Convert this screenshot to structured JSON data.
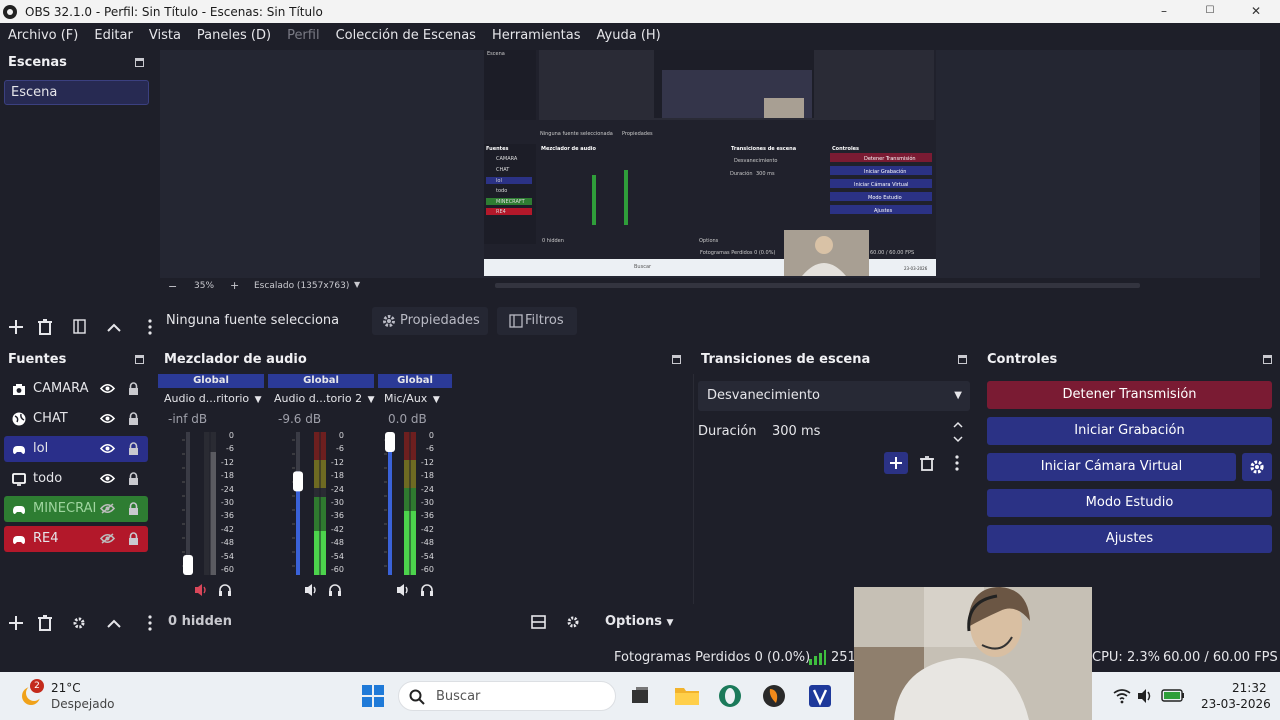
{
  "window": {
    "title": "OBS 32.1.0 - Perfil: Sin Título - Escenas: Sin Título",
    "min": "–",
    "max": "☐",
    "close": "✕"
  },
  "menu": [
    "Archivo (F)",
    "Editar",
    "Vista",
    "Paneles (D)",
    "Perfil",
    "Colección de Escenas",
    "Herramientas",
    "Ayuda (H)"
  ],
  "scenes": {
    "title": "Escenas",
    "items": [
      "Escena"
    ]
  },
  "preview": {
    "zoom": "35%",
    "scale_label": "Escalado (1357x763)",
    "inner": {
      "scene": "Escena",
      "no_source": "Ninguna fuente seleccionada",
      "props": "Propiedades",
      "filters": "Filtros",
      "sources_title": "Fuentes",
      "mixer_title": "Mezclador de audio",
      "transitions_title": "Transiciones de escena",
      "controls_title": "Controles",
      "fade": "Desvanecimiento",
      "duration": "Duración",
      "duration_value": "300 ms",
      "sources": [
        "CAMARA",
        "CHAT",
        "lol",
        "todo",
        "MINECRAFT",
        "RE4"
      ],
      "controls": [
        "Detener Transmisión",
        "Iniciar Grabación",
        "Iniciar Cámara Virtual",
        "Modo Estudio",
        "Ajustes"
      ],
      "status": "Fotogramas Perdidos 0 (0.0%)",
      "cpu": "CPU: 2.3%",
      "fps": "60.00 / 60.00 FPS",
      "search": "Buscar",
      "hidden": "0 hidden",
      "options": "Options",
      "time": "23-03-2026"
    }
  },
  "context": {
    "no_source": "Ninguna fuente selecciona",
    "properties": "Propiedades",
    "filters": "Filtros"
  },
  "sources": {
    "title": "Fuentes",
    "items": [
      {
        "name": "CAMARA",
        "icon": "camera-icon",
        "state": "normal"
      },
      {
        "name": "CHAT",
        "icon": "globe-icon",
        "state": "normal"
      },
      {
        "name": "lol",
        "icon": "gamepad-icon",
        "state": "blue"
      },
      {
        "name": "todo",
        "icon": "monitor-icon",
        "state": "normal"
      },
      {
        "name": "MINECRAI",
        "icon": "gamepad-icon",
        "state": "green"
      },
      {
        "name": "RE4",
        "icon": "gamepad-icon",
        "state": "red"
      }
    ]
  },
  "mixer": {
    "title": "Mezclador de audio",
    "channels": [
      {
        "header": "Global",
        "name": "Audio d...ritorio",
        "db": "-inf dB",
        "level": 0.0,
        "muted": true
      },
      {
        "header": "Global",
        "name": "Audio d...torio 2",
        "db": "-9.6 dB",
        "level": 0.68,
        "muted": false
      },
      {
        "header": "Global",
        "name": "Mic/Aux",
        "db": "0.0 dB",
        "level": 1.0,
        "muted": false
      }
    ],
    "scale": [
      "0",
      "-6",
      "-12",
      "-18",
      "-24",
      "-30",
      "-36",
      "-42",
      "-48",
      "-54",
      "-60"
    ],
    "hidden": "0 hidden",
    "options": "Options"
  },
  "transitions": {
    "title": "Transiciones de escena",
    "selected": "Desvanecimiento",
    "duration_label": "Duración",
    "duration_value": "300 ms"
  },
  "controls": {
    "title": "Controles",
    "stop_stream": "Detener Transmisión",
    "record": "Iniciar Grabación",
    "virtual_cam": "Iniciar Cámara Virtual",
    "studio": "Modo Estudio",
    "settings": "Ajustes"
  },
  "status": {
    "dropped": "Fotogramas Perdidos 0 (0.0%)",
    "bitrate_partial": "251",
    "cpu": "CPU: 2.3%",
    "fps": "60.00 / 60.00 FPS"
  },
  "taskbar": {
    "weather_badge": "2",
    "temp": "21°C",
    "weather": "Despejado",
    "search": "Buscar",
    "time": "21:32",
    "date": "23-03-2026"
  },
  "colors": {
    "bg": "#1e1f29",
    "accent_blue": "#2b3285",
    "stop_red": "#7a1b33",
    "green_src": "#2e7d32",
    "red_src": "#b3182a"
  }
}
